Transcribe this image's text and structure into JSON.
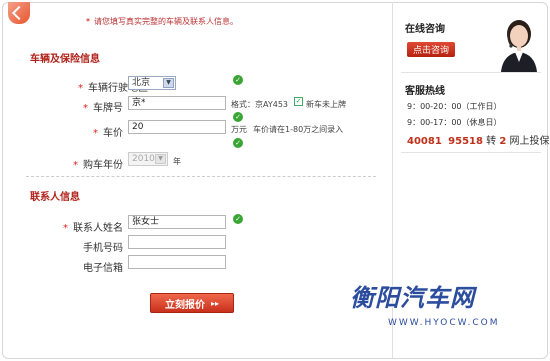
{
  "notice": "请您填写真实完整的车辆及联系人信息。",
  "vehicle_section": {
    "title": "车辆及保险信息",
    "region_label": "车辆行驶地区",
    "region_value": "北京",
    "plate_label": "车牌号",
    "plate_value": "京*",
    "plate_hint": "格式：京AY453",
    "new_car_label": "新车未上牌",
    "price_label": "车价",
    "price_value": "20",
    "price_unit": "万元",
    "price_hint": "车价请在1-80万之间录入",
    "year_label": "购车年份",
    "year_value": "2010",
    "year_unit": "年"
  },
  "contact_section": {
    "title": "联系人信息",
    "name_label": "联系人姓名",
    "name_value": "张女士",
    "mobile_label": "手机号码",
    "email_label": "电子信箱"
  },
  "submit_label": "立刻报价",
  "sidebar": {
    "consult_title": "在线咨询",
    "consult_button": "点击咨询",
    "hotline_title": "客服热线",
    "hours_weekday": "9：00-20：00（工作日）",
    "hours_holiday": "9：00-17：00（休息日）",
    "phone_part1": "40081",
    "phone_part2": "95518",
    "phone_mid": "转",
    "phone_ext": "2",
    "phone_suffix": "网上投保"
  },
  "watermark": {
    "brand": "衡阳汽车网",
    "url": "WWW.HYOCW.COM"
  },
  "colors": {
    "accent_red": "#b0241b",
    "ok_green": "#3aa535",
    "watermark_blue": "#2c4d9e"
  }
}
